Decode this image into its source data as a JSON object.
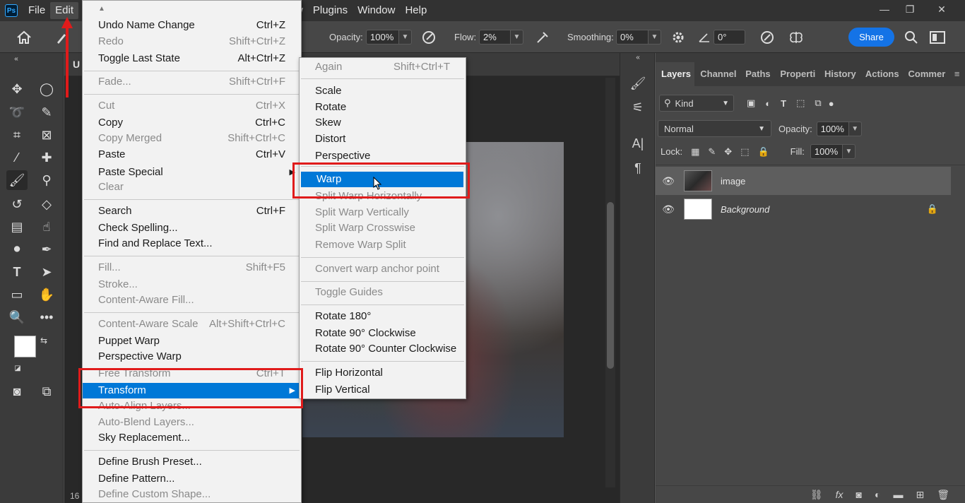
{
  "menubar": {
    "logo": "Ps",
    "items": [
      "File",
      "Edit",
      "w",
      "Plugins",
      "Window",
      "Help"
    ],
    "window_controls": [
      "—",
      "❐",
      "✕"
    ]
  },
  "options": {
    "opacity_label": "Opacity:",
    "opacity_value": "100%",
    "flow_label": "Flow:",
    "flow_value": "2%",
    "smoothing_label": "Smoothing:",
    "smoothing_value": "0%",
    "angle_value": "0°",
    "share_label": "Share"
  },
  "document": {
    "tab_label": "U",
    "status_zoom": "16"
  },
  "panel": {
    "tabs": [
      "Layers",
      "Channel",
      "Paths",
      "Properti",
      "History",
      "Actions",
      "Commer"
    ],
    "kind_label": "Kind",
    "blend_mode": "Normal",
    "opacity_label": "Opacity:",
    "opacity_value": "100%",
    "lock_label": "Lock:",
    "fill_label": "Fill:",
    "fill_value": "100%",
    "layers": [
      {
        "name": "image"
      },
      {
        "name": "Background"
      }
    ]
  },
  "edit_menu": {
    "items": [
      {
        "label": "Undo Name Change",
        "shortcut": "Ctrl+Z"
      },
      {
        "label": "Redo",
        "shortcut": "Shift+Ctrl+Z"
      },
      {
        "label": "Toggle Last State",
        "shortcut": "Alt+Ctrl+Z"
      },
      {
        "label": "Fade...",
        "shortcut": "Shift+Ctrl+F"
      },
      {
        "label": "Cut",
        "shortcut": "Ctrl+X"
      },
      {
        "label": "Copy",
        "shortcut": "Ctrl+C"
      },
      {
        "label": "Copy Merged",
        "shortcut": "Shift+Ctrl+C"
      },
      {
        "label": "Paste",
        "shortcut": "Ctrl+V"
      },
      {
        "label": "Paste Special",
        "shortcut": ""
      },
      {
        "label": "Clear",
        "shortcut": ""
      },
      {
        "label": "Search",
        "shortcut": "Ctrl+F"
      },
      {
        "label": "Check Spelling...",
        "shortcut": ""
      },
      {
        "label": "Find and Replace Text...",
        "shortcut": ""
      },
      {
        "label": "Fill...",
        "shortcut": "Shift+F5"
      },
      {
        "label": "Stroke...",
        "shortcut": ""
      },
      {
        "label": "Content-Aware Fill...",
        "shortcut": ""
      },
      {
        "label": "Content-Aware Scale",
        "shortcut": "Alt+Shift+Ctrl+C"
      },
      {
        "label": "Puppet Warp",
        "shortcut": ""
      },
      {
        "label": "Perspective Warp",
        "shortcut": ""
      },
      {
        "label": "Free Transform",
        "shortcut": "Ctrl+T"
      },
      {
        "label": "Transform",
        "shortcut": ""
      },
      {
        "label": "Auto-Align Layers...",
        "shortcut": ""
      },
      {
        "label": "Auto-Blend Layers...",
        "shortcut": ""
      },
      {
        "label": "Sky Replacement...",
        "shortcut": ""
      },
      {
        "label": "Define Brush Preset...",
        "shortcut": ""
      },
      {
        "label": "Define Pattern...",
        "shortcut": ""
      },
      {
        "label": "Define Custom Shape...",
        "shortcut": ""
      }
    ]
  },
  "transform_menu": {
    "items": [
      {
        "label": "Again",
        "shortcut": "Shift+Ctrl+T"
      },
      {
        "label": "Scale"
      },
      {
        "label": "Rotate"
      },
      {
        "label": "Skew"
      },
      {
        "label": "Distort"
      },
      {
        "label": "Perspective"
      },
      {
        "label": "Warp"
      },
      {
        "label": "Split Warp Horizontally"
      },
      {
        "label": "Split Warp Vertically"
      },
      {
        "label": "Split Warp Crosswise"
      },
      {
        "label": "Remove Warp Split"
      },
      {
        "label": "Convert warp anchor point"
      },
      {
        "label": "Toggle Guides"
      },
      {
        "label": "Rotate 180°"
      },
      {
        "label": "Rotate 90° Clockwise"
      },
      {
        "label": "Rotate 90° Counter Clockwise"
      },
      {
        "label": "Flip Horizontal"
      },
      {
        "label": "Flip Vertical"
      }
    ]
  },
  "colors": {
    "highlight": "#0078d7",
    "annotation": "#e01b1b",
    "share": "#1473e6"
  }
}
